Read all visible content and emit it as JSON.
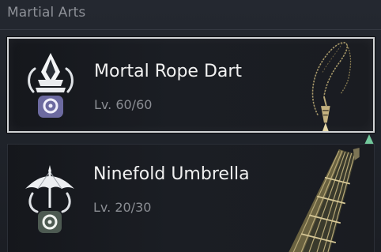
{
  "section": {
    "title": "Martial Arts"
  },
  "arts": [
    {
      "name": "Mortal Rope Dart",
      "level": "Lv. 60/60",
      "selected": true,
      "icon": "rope-dart-emblem-icon",
      "weapon_image": "rope-dart-weapon"
    },
    {
      "name": "Ninefold Umbrella",
      "level": "Lv. 20/30",
      "selected": false,
      "icon": "umbrella-emblem-icon",
      "weapon_image": "umbrella-weapon"
    }
  ],
  "indicator": {
    "icon": "upgrade-arrow-icon",
    "color": "#72c89c"
  },
  "colors": {
    "background": "#22262d",
    "card": "#1b1e24",
    "selected_border": "#d2d4d6",
    "name_text": "#f1f1f1",
    "level_text": "#8b8e94",
    "section_title": "#8d9097"
  }
}
